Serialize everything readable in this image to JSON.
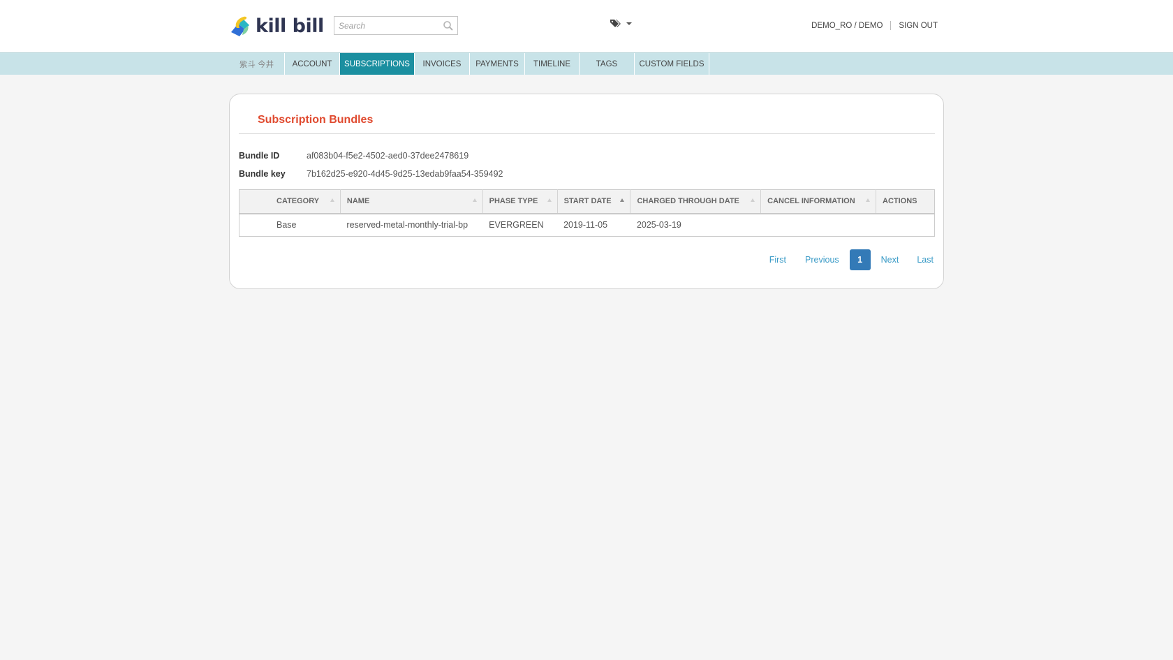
{
  "header": {
    "brand": "kill bill",
    "search_placeholder": "Search",
    "user": "DEMO_RO / DEMO",
    "sign_out": "SIGN OUT"
  },
  "nav": {
    "items": [
      {
        "label": "紫斗 今井"
      },
      {
        "label": "ACCOUNT"
      },
      {
        "label": "SUBSCRIPTIONS"
      },
      {
        "label": "INVOICES"
      },
      {
        "label": "PAYMENTS"
      },
      {
        "label": "TIMELINE"
      },
      {
        "label": "TAGS"
      },
      {
        "label": "CUSTOM FIELDS"
      }
    ],
    "active": "SUBSCRIPTIONS"
  },
  "panel": {
    "title": "Subscription Bundles",
    "bundle_id_label": "Bundle ID",
    "bundle_id": "af083b04-f5e2-4502-aed0-37dee2478619",
    "bundle_key_label": "Bundle key",
    "bundle_key": "7b162d25-e920-4d45-9d25-13edab9faa54-359492"
  },
  "table": {
    "columns": [
      "CATEGORY",
      "NAME",
      "PHASE TYPE",
      "START DATE",
      "CHARGED THROUGH DATE",
      "CANCEL INFORMATION",
      "ACTIONS"
    ],
    "rows": [
      {
        "category": "Base",
        "name": "reserved-metal-monthly-trial-bp",
        "phase_type": "EVERGREEN",
        "start_date": "2019-11-05",
        "charged_through": "2025-03-19",
        "cancel_info": "",
        "actions": ""
      }
    ]
  },
  "pagination": {
    "first": "First",
    "previous": "Previous",
    "current": "1",
    "next": "Next",
    "last": "Last"
  },
  "colors": {
    "accent": "#1b8fa0",
    "nav_bg": "#c8e3e8",
    "title": "#e04a2f",
    "link": "#3a9bc7",
    "page_active": "#337ab7"
  },
  "icons": {
    "logo": "killbill-logo-icon",
    "search": "search-icon",
    "tags": "tags-icon",
    "caret": "chevron-down-icon"
  }
}
